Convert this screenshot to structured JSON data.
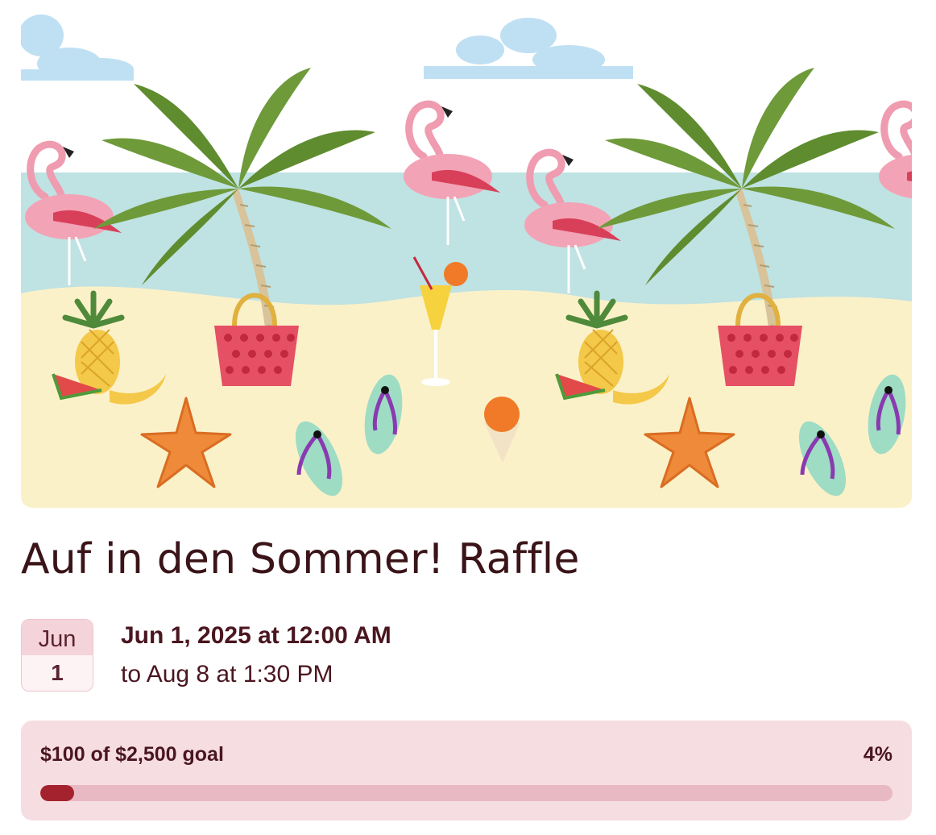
{
  "event": {
    "title": "Auf in den Sommer! Raffle",
    "banner_theme": "summer beach illustration"
  },
  "date_badge": {
    "month": "Jun",
    "day": "1"
  },
  "schedule": {
    "start": "Jun 1, 2025 at 12:00 AM",
    "end": "to Aug 8 at 1:30 PM"
  },
  "fundraising": {
    "summary": "$100 of $2,500 goal",
    "percent_label": "4%",
    "progress_fraction": 0.04
  },
  "colors": {
    "accent": "#a4222e",
    "card_bg": "#f6dde1",
    "track": "#e8b9c2",
    "text": "#3a1418"
  }
}
